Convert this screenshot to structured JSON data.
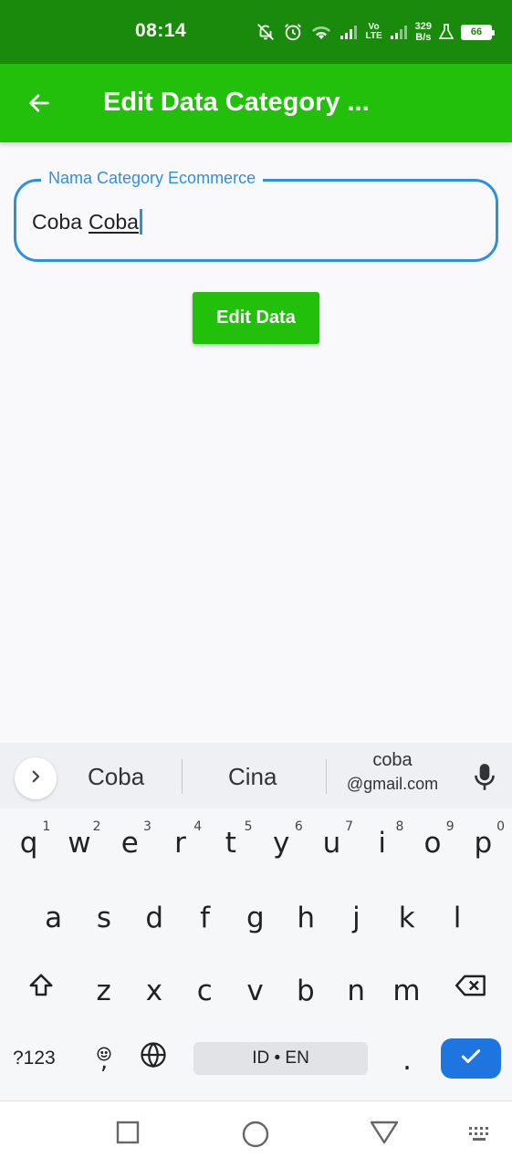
{
  "status_bar": {
    "time": "08:14",
    "volte_top": "Vo",
    "volte_bottom": "LTE",
    "speed_value": "329",
    "speed_unit": "B/s",
    "battery": "66",
    "icons": [
      "mute-icon",
      "alarm-icon",
      "wifi-icon",
      "signal-icon",
      "signal-icon",
      "flask-icon",
      "battery-icon"
    ]
  },
  "app_bar": {
    "back_icon": "arrow-left-icon",
    "title": "Edit Data Category ..."
  },
  "form": {
    "label": "Nama Category Ecommerce",
    "value_part1": "Coba",
    "value_part2": "Coba"
  },
  "edit_button": {
    "label": "Edit Data"
  },
  "keyboard": {
    "suggestions": [
      "Coba",
      "Cina"
    ],
    "email_suggestion_top": "coba",
    "email_suggestion_bottom": "@gmail.com",
    "row1": [
      "q",
      "w",
      "e",
      "r",
      "t",
      "y",
      "u",
      "i",
      "o",
      "p"
    ],
    "row1_hints": [
      "1",
      "2",
      "3",
      "4",
      "5",
      "6",
      "7",
      "8",
      "9",
      "0"
    ],
    "row2": [
      "a",
      "s",
      "d",
      "f",
      "g",
      "h",
      "j",
      "k",
      "l"
    ],
    "row3": [
      "z",
      "x",
      "c",
      "v",
      "b",
      "n",
      "m"
    ],
    "symbols_label": "?123",
    "comma": ",",
    "period": ".",
    "space_label": "ID • EN"
  },
  "colors": {
    "status_bar": "#1a8a0c",
    "app_bar": "#22c00a",
    "accent": "#2f8fdf",
    "enter": "#1f75e0"
  }
}
